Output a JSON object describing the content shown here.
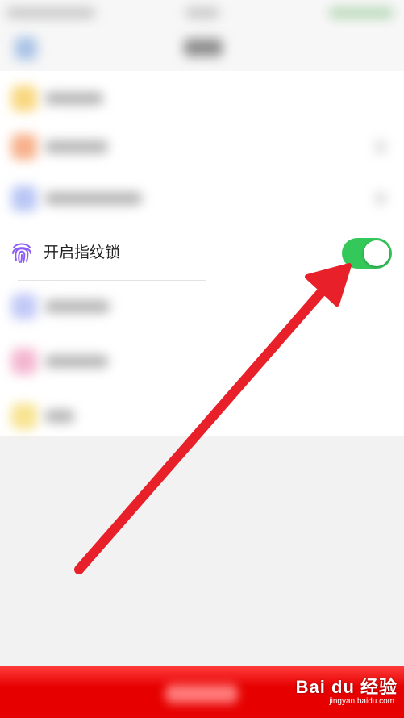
{
  "fingerprint_setting": {
    "label": "开启指纹锁",
    "icon": "fingerprint-icon",
    "toggle_state": "on"
  },
  "watermark": {
    "text": "Bai du 经验",
    "url": "jingyan.baidu.com"
  },
  "colors": {
    "toggle_on": "#34c759",
    "fingerprint_icon": "#8b5cf6",
    "annotation_arrow": "#e8202a",
    "bottom_bar": "#e60000"
  }
}
